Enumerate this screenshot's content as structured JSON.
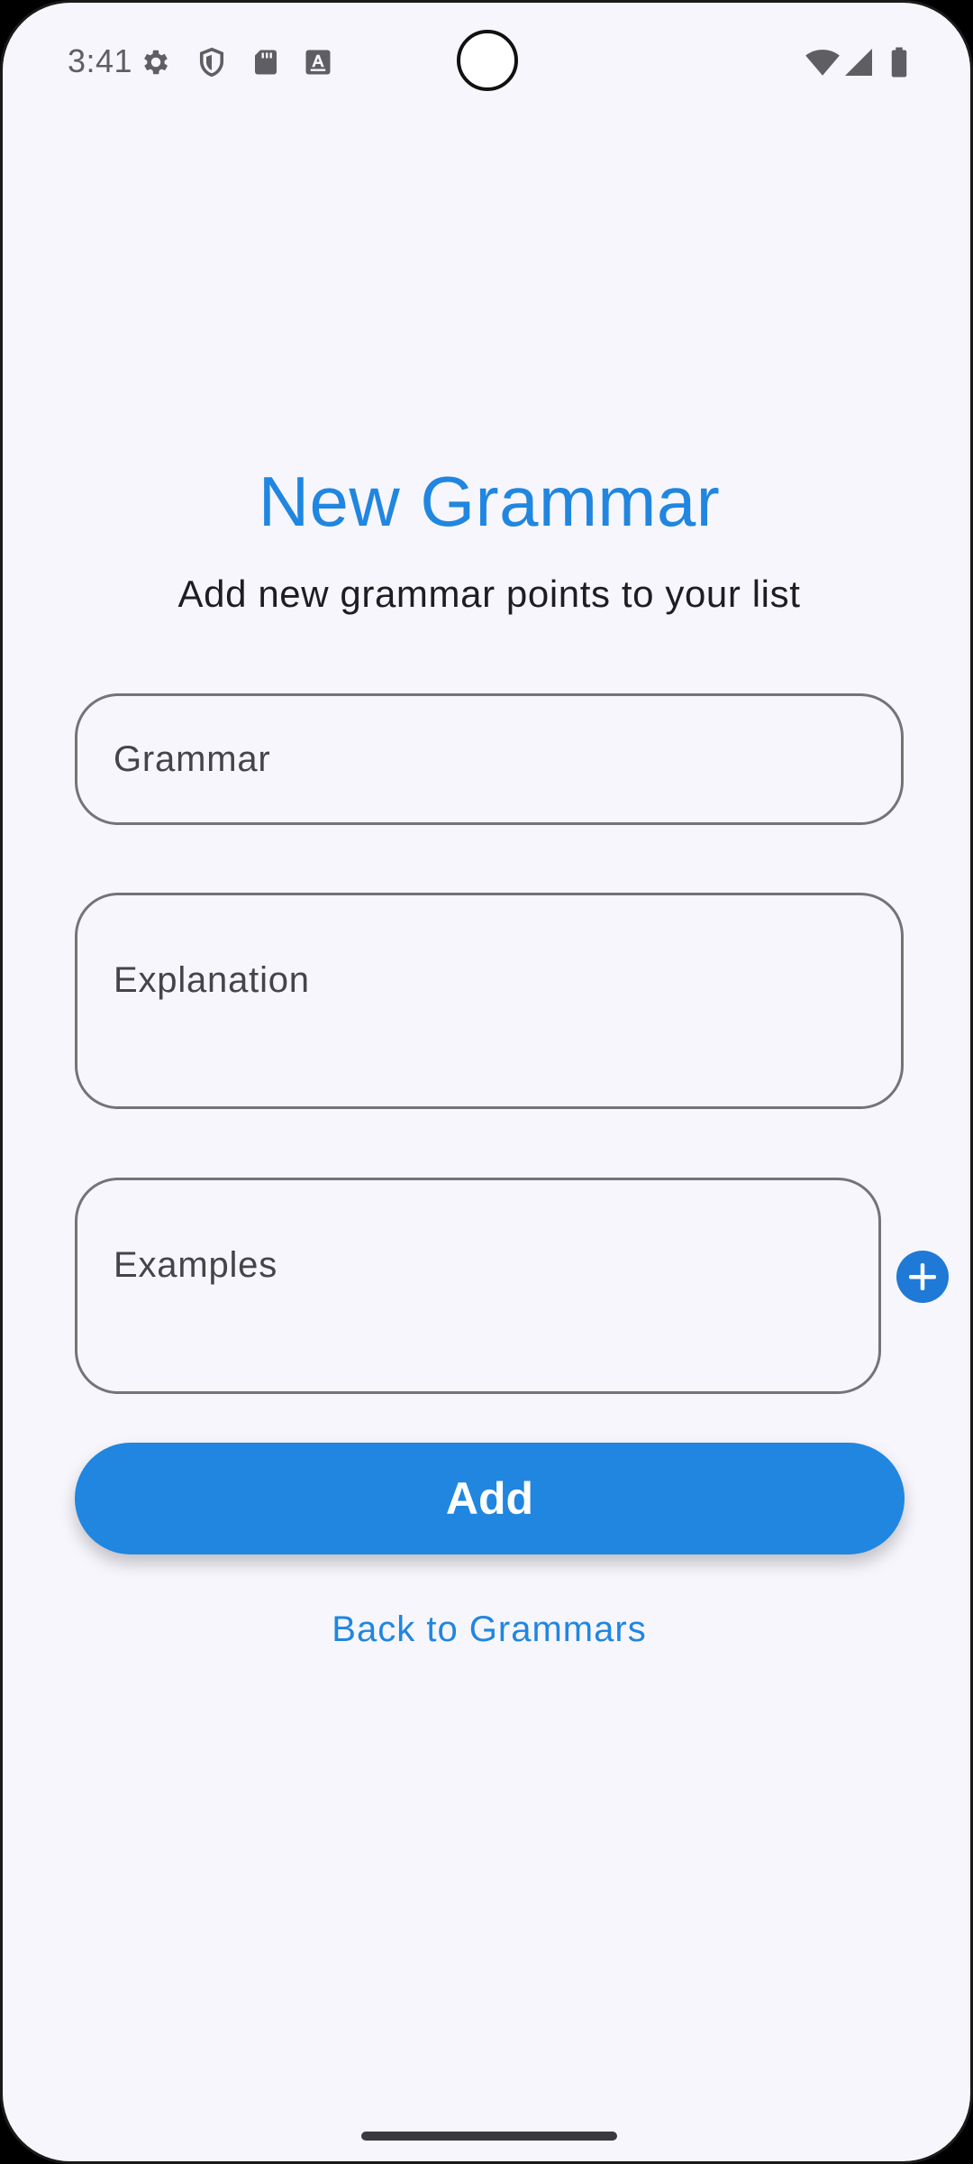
{
  "status_bar": {
    "time": "3:41",
    "left_icons": [
      "settings-icon",
      "shield-icon",
      "sd-card-icon",
      "text-icon"
    ],
    "right_icons": [
      "wifi-icon",
      "cell-signal-icon",
      "battery-icon"
    ]
  },
  "screen": {
    "title": "New Grammar",
    "subtitle": "Add new grammar points to your list"
  },
  "form": {
    "grammar_label": "Grammar",
    "explanation_label": "Explanation",
    "examples_label": "Examples",
    "add_example_icon": "plus-circle-icon",
    "submit_label": "Add",
    "back_link": "Back to Grammars"
  },
  "colors": {
    "accent": "#2086e0",
    "background": "#f7f6fc",
    "outline": "#75737a"
  }
}
